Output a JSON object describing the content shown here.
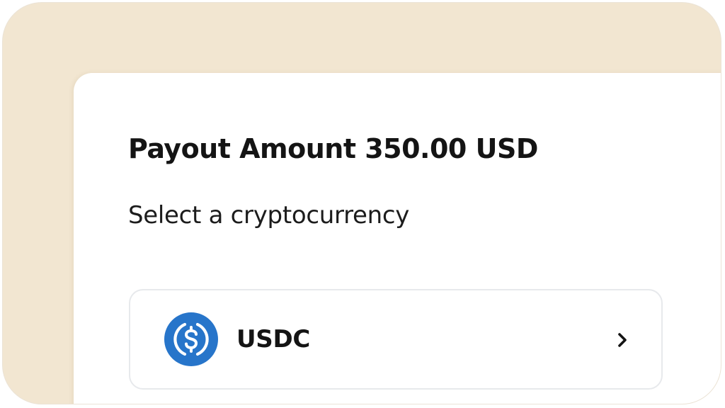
{
  "payout": {
    "title": "Payout Amount 350.00 USD",
    "subtitle": "Select a cryptocurrency"
  },
  "options": [
    {
      "label": "USDC",
      "icon": "usdc-coin-icon",
      "action_icon": "chevron-right-icon"
    }
  ],
  "colors": {
    "frame_background": "#f2e6d1",
    "panel_background": "#ffffff",
    "usdc_blue": "#2775ca",
    "text": "#141414",
    "card_border": "#e7e9ec"
  }
}
